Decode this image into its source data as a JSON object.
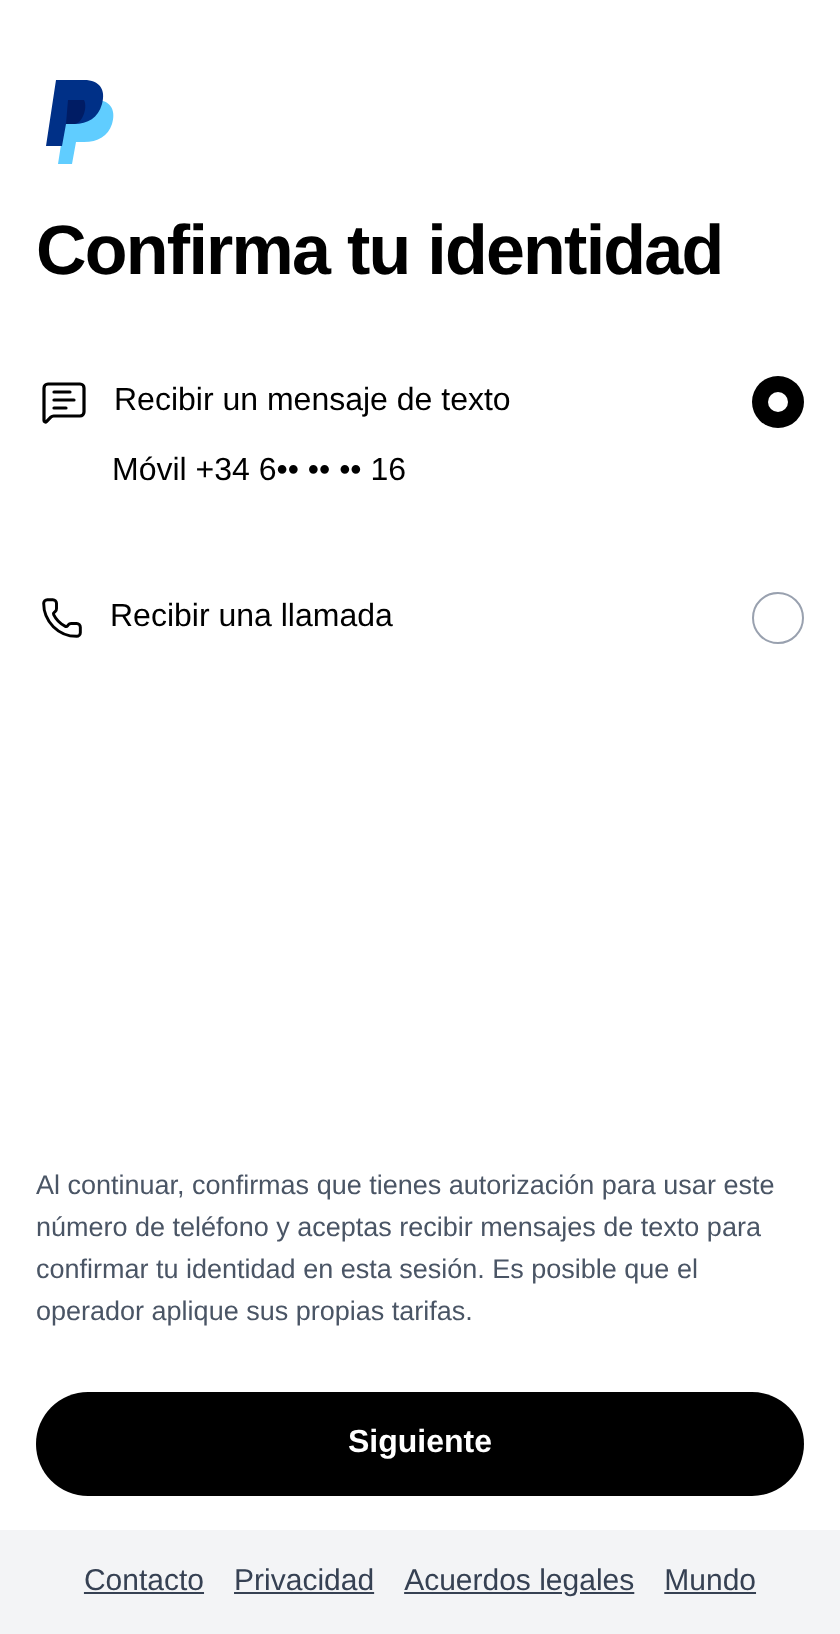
{
  "title": "Confirma tu identidad",
  "options": [
    {
      "kind": "sms",
      "label": "Recibir un mensaje de texto",
      "detail": "Móvil +34 6•• •• •• 16",
      "selected": true
    },
    {
      "kind": "call",
      "label": "Recibir una llamada",
      "selected": false
    }
  ],
  "disclaimer": "Al continuar, confirmas que tienes autorización para usar este número de teléfono y aceptas recibir mensajes de texto para confirmar tu identidad en esta sesión. Es posible que el operador aplique sus propias tarifas.",
  "button": "Siguiente",
  "footer_links": [
    "Contacto",
    "Privacidad",
    "Acuerdos legales",
    "Mundo"
  ]
}
